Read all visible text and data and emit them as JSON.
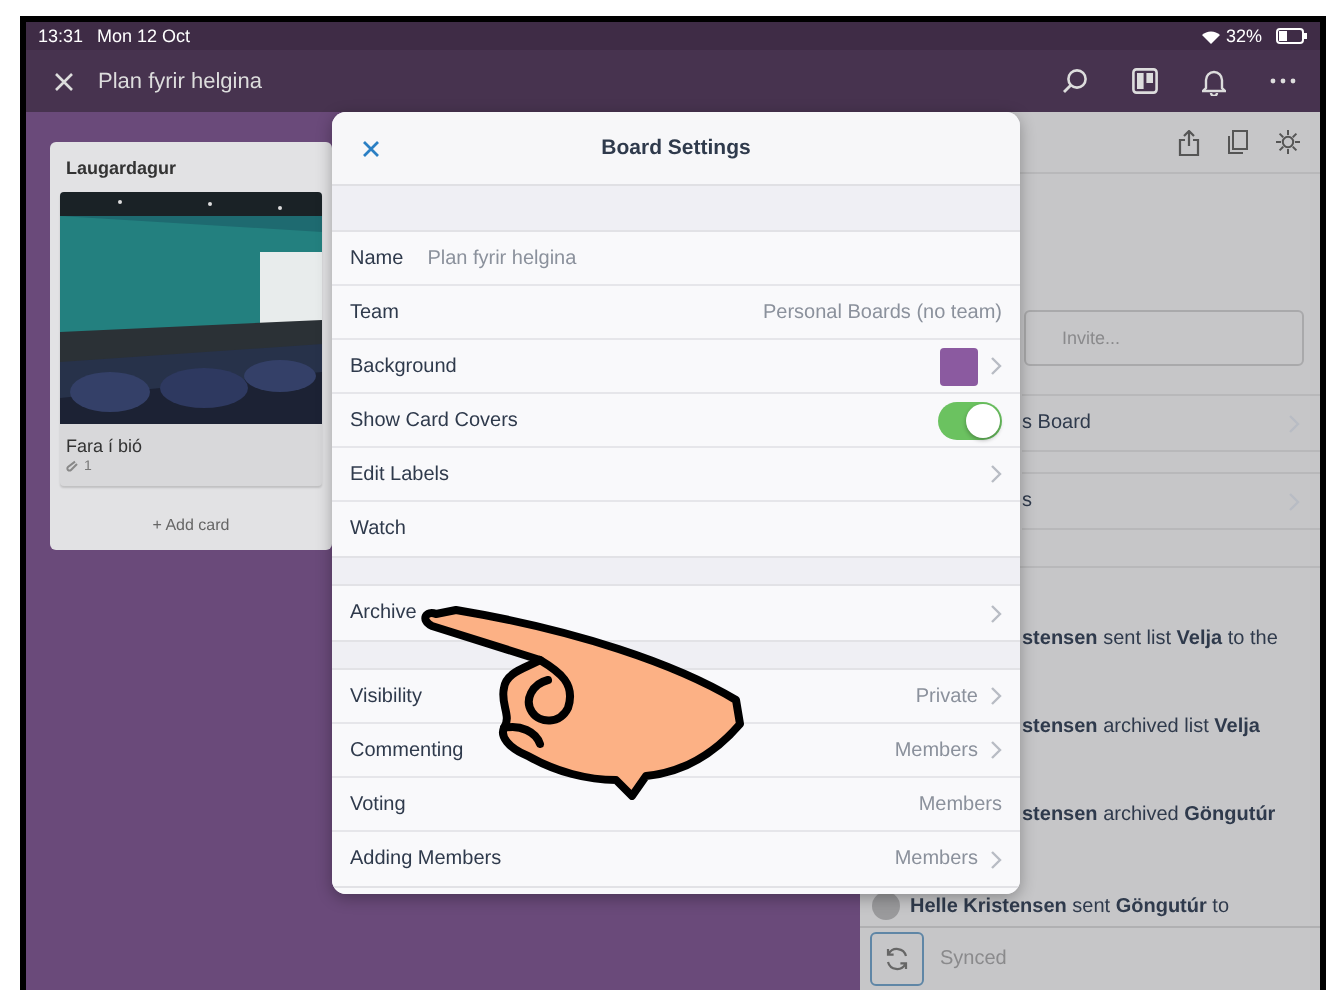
{
  "status_bar": {
    "time": "13:31",
    "date": "Mon 12 Oct",
    "battery": "32%"
  },
  "nav": {
    "title": "Plan fyrir helgina"
  },
  "list": {
    "title": "Laugardagur",
    "card": {
      "title": "Fara í bió",
      "attachments": "1"
    },
    "add": "+ Add card"
  },
  "side_panel": {
    "invite": {
      "placeholder": "Invite..."
    },
    "rows": [
      {
        "label": "s Board"
      },
      {
        "label": "s"
      }
    ],
    "activity": [
      {
        "text": "**stensen** sent list **Velja** to the",
        "avatar": false
      },
      {
        "text": "**stensen** archived list **Velja**",
        "avatar": false
      },
      {
        "text": "**stensen** archived **Göngutúr**",
        "avatar": false
      },
      {
        "text": "**Helle Kristensen** sent **Göngutúr** to",
        "avatar": true
      }
    ],
    "sync": "Synced"
  },
  "dialog": {
    "title": "Board Settings",
    "sections": [
      [
        {
          "kind": "field",
          "label": "Name",
          "value": "Plan fyrir helgina",
          "chevron": false
        },
        {
          "kind": "value",
          "label": "Team",
          "value": "Personal Boards (no team)",
          "chevron": false
        },
        {
          "kind": "color",
          "label": "Background",
          "color": "#8b5aa0",
          "chevron": true
        },
        {
          "kind": "toggle",
          "label": "Show Card Covers",
          "on": true,
          "chevron": false
        },
        {
          "kind": "plain",
          "label": "Edit Labels",
          "chevron": true
        },
        {
          "kind": "plain",
          "label": "Watch",
          "chevron": false
        }
      ],
      [
        {
          "kind": "plain",
          "label": "Archive",
          "chevron": true
        }
      ],
      [
        {
          "kind": "value",
          "label": "Visibility",
          "value": "Private",
          "chevron": true
        },
        {
          "kind": "value",
          "label": "Commenting",
          "value": "Members",
          "chevron": true
        },
        {
          "kind": "value",
          "label": "Voting",
          "value": "Members",
          "chevron": false
        },
        {
          "kind": "value",
          "label": "Adding Members",
          "value": "Members",
          "chevron": true
        }
      ]
    ]
  },
  "annotation": {
    "kind": "pointing-hand"
  }
}
